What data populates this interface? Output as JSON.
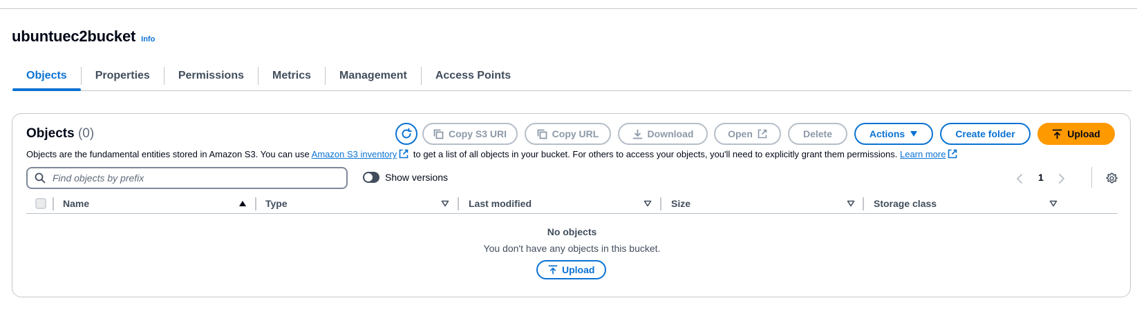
{
  "bucket": {
    "name": "ubuntuec2bucket",
    "info_label": "Info"
  },
  "tabs": [
    {
      "label": "Objects"
    },
    {
      "label": "Properties"
    },
    {
      "label": "Permissions"
    },
    {
      "label": "Metrics"
    },
    {
      "label": "Management"
    },
    {
      "label": "Access Points"
    }
  ],
  "objects_panel": {
    "title": "Objects",
    "count": "(0)",
    "description_before": "Objects are the fundamental entities stored in Amazon S3. You can use",
    "inventory_link": "Amazon S3 inventory",
    "description_middle": "to get a list of all objects in your bucket. For others to access your objects, you'll need to explicitly grant them permissions.",
    "learn_more": "Learn more"
  },
  "toolbar": {
    "copy_s3_uri": "Copy S3 URI",
    "copy_url": "Copy URL",
    "download": "Download",
    "open": "Open",
    "delete": "Delete",
    "actions": "Actions",
    "create_folder": "Create folder",
    "upload": "Upload"
  },
  "search": {
    "placeholder": "Find objects by prefix"
  },
  "show_versions": {
    "label": "Show versions",
    "enabled": false
  },
  "pagination": {
    "current_page": "1"
  },
  "table": {
    "columns": [
      {
        "label": "Name"
      },
      {
        "label": "Type"
      },
      {
        "label": "Last modified"
      },
      {
        "label": "Size"
      },
      {
        "label": "Storage class"
      }
    ]
  },
  "empty_state": {
    "title": "No objects",
    "message": "You don't have any objects in this bucket.",
    "upload_label": "Upload"
  },
  "colors": {
    "link_blue": "#0972d3",
    "upload_orange": "#ff9900",
    "text_dark": "#000716",
    "text_secondary": "#414d5c",
    "disabled": "#8d99a8"
  }
}
